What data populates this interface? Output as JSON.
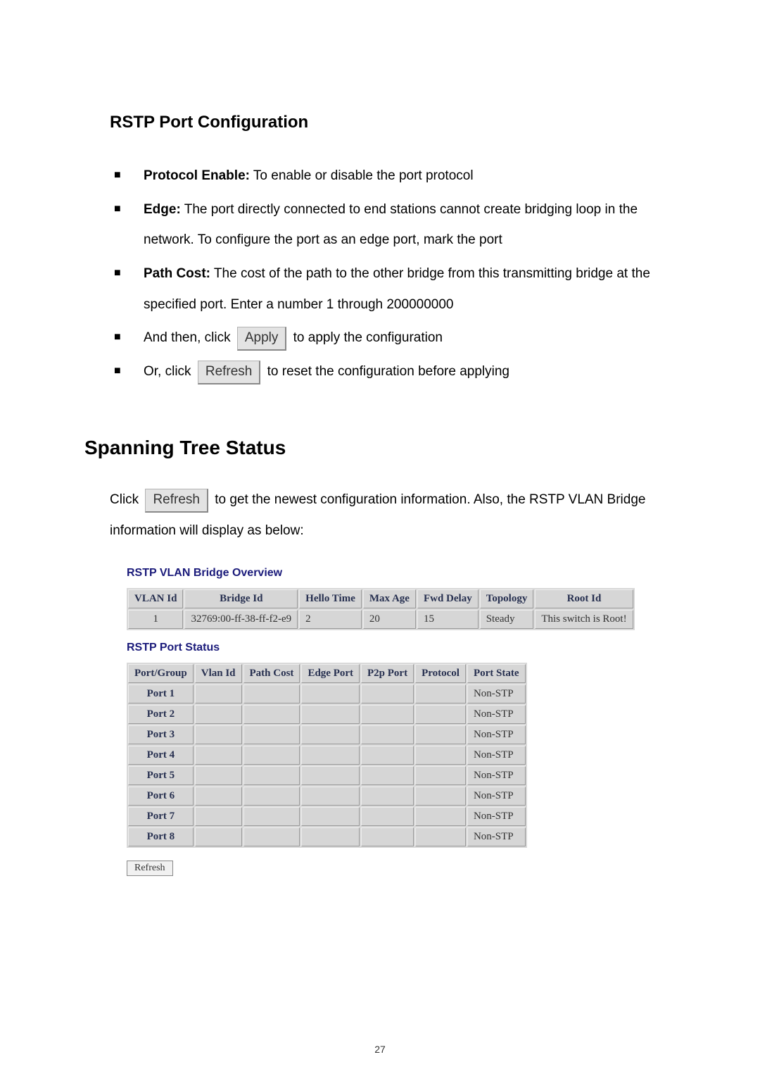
{
  "section1": {
    "title": "RSTP Port Configuration",
    "items": [
      {
        "label": "Protocol Enable:",
        "text": " To enable or disable the port protocol"
      },
      {
        "label": "Edge:",
        "text": " The port directly connected to end stations cannot create bridging loop in the network. To configure the port as an edge port, mark the port"
      },
      {
        "label": "Path Cost:",
        "text": " The cost of the path to the other bridge from this transmitting bridge at the specified port. Enter a number 1 through 200000000"
      }
    ],
    "apply_pre": "And then, click ",
    "apply_btn": "Apply",
    "apply_post": " to apply the configuration",
    "refresh_pre": "Or, click ",
    "refresh_btn": "Refresh",
    "refresh_post": " to reset the configuration before applying"
  },
  "section2": {
    "title": "Spanning Tree Status",
    "para_pre": "Click ",
    "para_btn": "Refresh",
    "para_post": " to get the newest configuration information. Also, the RSTP VLAN Bridge information will display as below:"
  },
  "bridge_overview": {
    "title": "RSTP VLAN Bridge Overview",
    "headers": [
      "VLAN Id",
      "Bridge Id",
      "Hello Time",
      "Max Age",
      "Fwd Delay",
      "Topology",
      "Root Id"
    ],
    "row": [
      "1",
      "32769:00-ff-38-ff-f2-e9",
      "2",
      "20",
      "15",
      "Steady",
      "This switch is Root!"
    ]
  },
  "port_status": {
    "title": "RSTP Port Status",
    "headers": [
      "Port/Group",
      "Vlan Id",
      "Path Cost",
      "Edge Port",
      "P2p Port",
      "Protocol",
      "Port State"
    ],
    "rows": [
      {
        "port": "Port 1",
        "state": "Non-STP"
      },
      {
        "port": "Port 2",
        "state": "Non-STP"
      },
      {
        "port": "Port 3",
        "state": "Non-STP"
      },
      {
        "port": "Port 4",
        "state": "Non-STP"
      },
      {
        "port": "Port 5",
        "state": "Non-STP"
      },
      {
        "port": "Port 6",
        "state": "Non-STP"
      },
      {
        "port": "Port 7",
        "state": "Non-STP"
      },
      {
        "port": "Port 8",
        "state": "Non-STP"
      }
    ],
    "refresh_btn": "Refresh"
  },
  "page_number": "27"
}
